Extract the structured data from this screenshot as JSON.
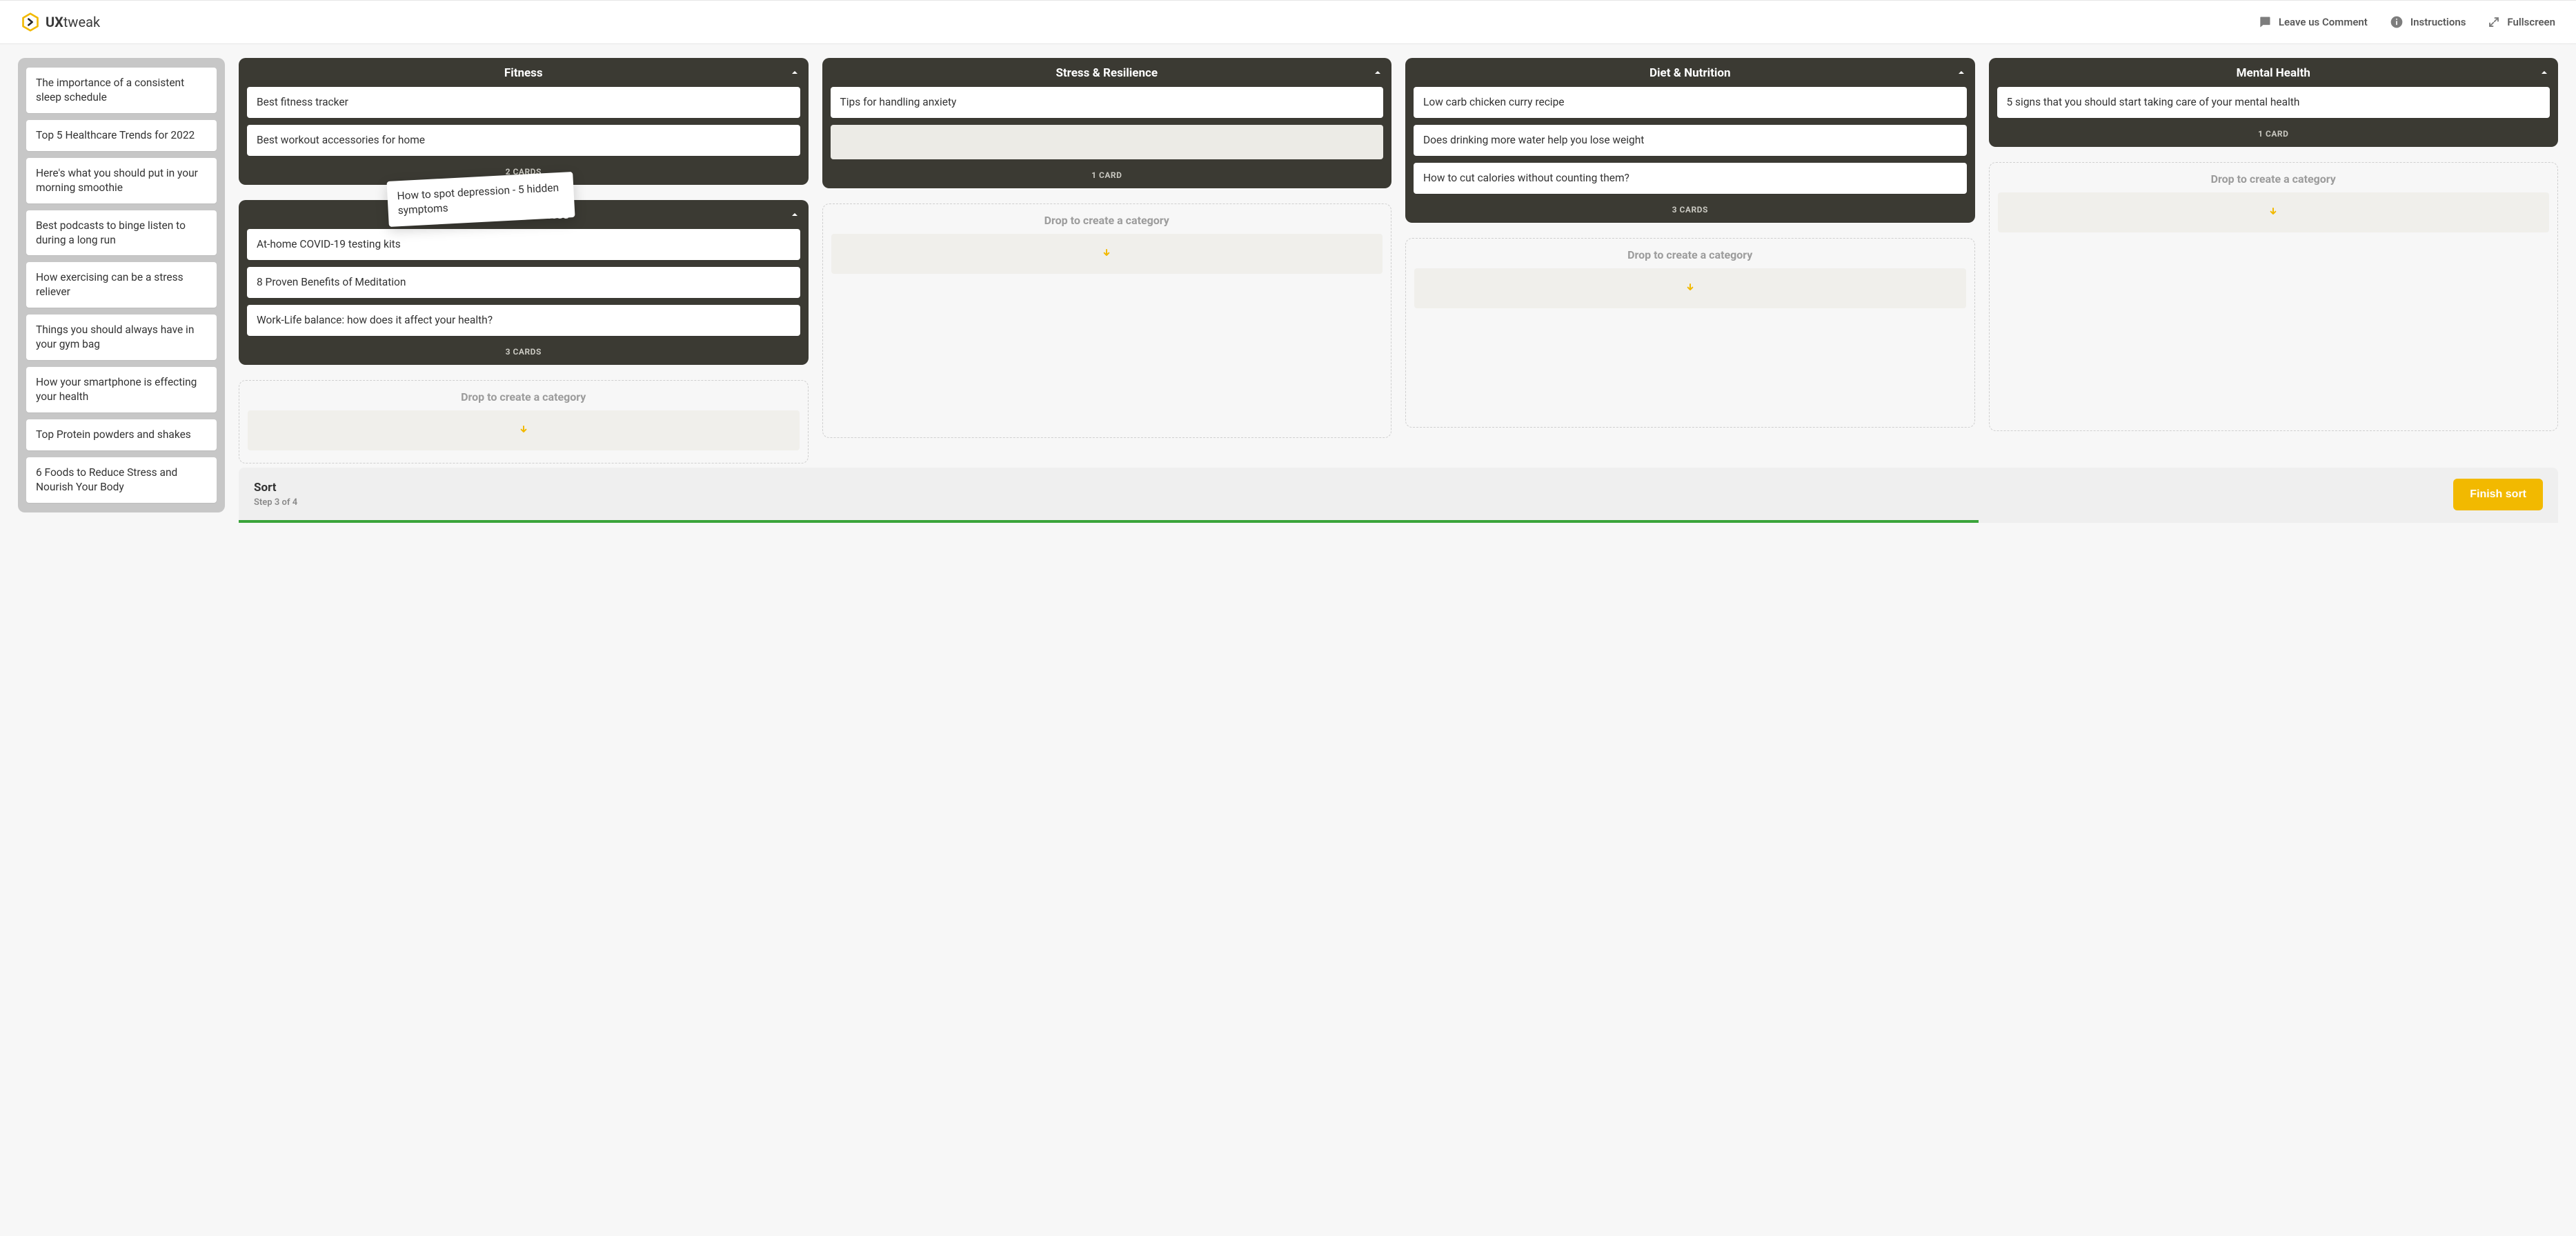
{
  "app": {
    "name_bold": "UX",
    "name_rest": "tweak"
  },
  "header": {
    "comment": "Leave us Comment",
    "instructions": "Instructions",
    "fullscreen": "Fullscreen"
  },
  "unsorted": [
    "The importance of a consistent sleep schedule",
    "Top 5 Healthcare Trends for 2022",
    "Here's what you should put in your morning smoothie",
    "Best podcasts to binge listen to during a long run",
    "How exercising can be a stress reliever",
    "Things you should always have in your gym bag",
    "How your smartphone is effecting your health",
    "Top Protein powders and shakes",
    "6 Foods to Reduce Stress and Nourish Your Body"
  ],
  "categories": {
    "fitness": {
      "title": "Fitness",
      "cards": [
        "Best fitness tracker",
        "Best workout accessories for home"
      ],
      "count_label": "2 CARDS"
    },
    "stress": {
      "title": "Stress & Resilience",
      "cards": [
        "Tips for handling anxiety"
      ],
      "has_placeholder": true,
      "count_label": "1 CARD"
    },
    "diet": {
      "title": "Diet & Nutrition",
      "cards": [
        "Low carb chicken curry recipe",
        "Does drinking more water help you lose weight",
        "How to cut calories without counting them?"
      ],
      "count_label": "3 CARDS"
    },
    "mental": {
      "title": "Mental Health",
      "cards": [
        "5 signs that you should start taking care of your mental health"
      ],
      "count_label": "1 CARD"
    },
    "general": {
      "title": "General Wellness",
      "cards": [
        "At-home COVID-19 testing kits",
        "8 Proven Benefits of Meditation",
        "Work-Life balance: how does it affect your health?"
      ],
      "count_label": "3 CARDS"
    }
  },
  "dropzone_label": "Drop to create a category",
  "dragging_card": "How to spot depression - 5 hidden symptoms",
  "bottom": {
    "title": "Sort",
    "step": "Step 3 of 4",
    "finish": "Finish sort",
    "progress_percent": 75
  },
  "colors": {
    "accent": "#f2b900",
    "category_bg": "#3b3a33"
  }
}
